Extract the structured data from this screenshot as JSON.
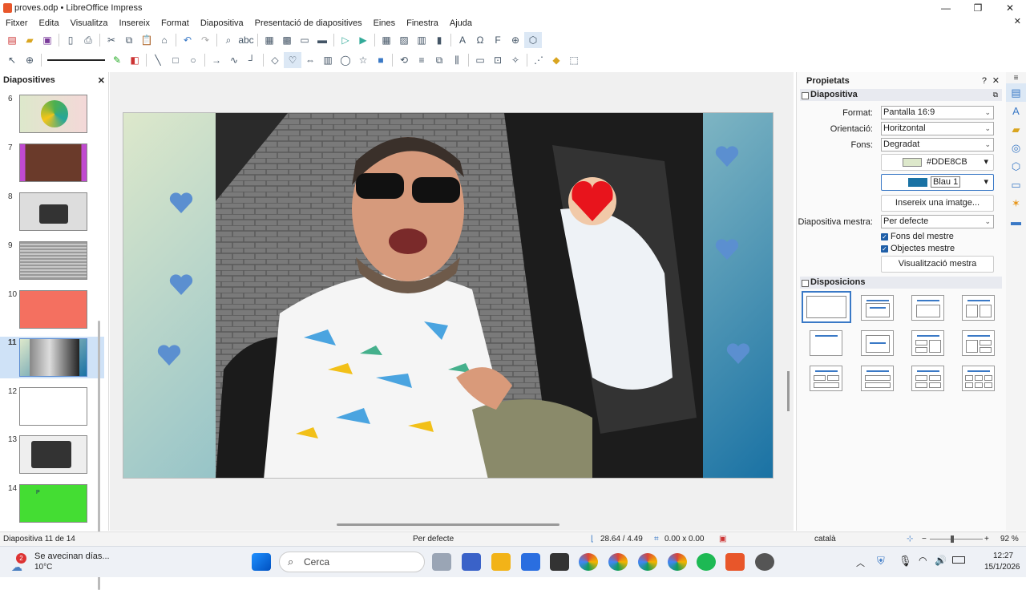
{
  "window": {
    "title": "proves.odp • LibreOffice Impress"
  },
  "menu": [
    "Fitxer",
    "Edita",
    "Visualitza",
    "Insereix",
    "Format",
    "Diapositiva",
    "Presentació de diapositives",
    "Eines",
    "Finestra",
    "Ajuda"
  ],
  "slide_panel": {
    "title": "Diapositives",
    "slides": [
      {
        "num": "6"
      },
      {
        "num": "7"
      },
      {
        "num": "8"
      },
      {
        "num": "9"
      },
      {
        "num": "10"
      },
      {
        "num": "11"
      },
      {
        "num": "12"
      },
      {
        "num": "13"
      },
      {
        "num": "14"
      }
    ],
    "selected": "11",
    "thumb14_text": "P"
  },
  "properties": {
    "title": "Propietats",
    "section_slide": "Diapositiva",
    "format_label": "Format:",
    "format_value": "Pantalla 16:9",
    "orientation_label": "Orientació:",
    "orientation_value": "Horitzontal",
    "background_label": "Fons:",
    "background_value": "Degradat",
    "color1_value": "#DDE8CB",
    "color2_value": "Blau 1",
    "insert_image_button": "Insereix una imatge...",
    "master_label": "Diapositiva mestra:",
    "master_value": "Per defecte",
    "master_bg_check": "Fons del mestre",
    "master_obj_check": "Objectes mestre",
    "master_view_button": "Visualització mestra",
    "section_layouts": "Disposicions"
  },
  "colors": {
    "gradient_start": "#DDE8CB",
    "gradient_end": "#1A72A4",
    "accent": "#3A79C6"
  },
  "statusbar": {
    "slide_info": "Diapositiva 11 de 14",
    "master": "Per defecte",
    "position": "28.64 / 4.49",
    "size": "0.00 x 0.00",
    "language": "català",
    "zoom": "92 %"
  },
  "taskbar": {
    "weather_title": "Se avecinan días...",
    "weather_temp": "10°C",
    "weather_badge": "2",
    "search_placeholder": "Cerca",
    "time": "12:27",
    "date": "15/1/2026"
  }
}
